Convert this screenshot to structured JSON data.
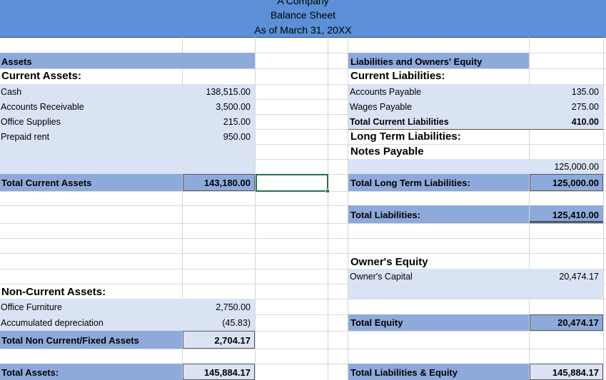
{
  "header": {
    "company": "A Company",
    "title": "Balance Sheet",
    "date": "As of March 31, 20XX"
  },
  "assets": {
    "heading": "Assets",
    "current_heading": "Current Assets:",
    "cash_label": "Cash",
    "cash_value": "138,515.00",
    "ar_label": "Accounts Receivable",
    "ar_value": "3,500.00",
    "supplies_label": "Office Supplies",
    "supplies_value": "215.00",
    "rent_label": "Prepaid rent",
    "rent_value": "950.00",
    "total_current_label": "Total Current Assets",
    "total_current_value": "143,180.00",
    "noncurrent_heading": "Non-Current Assets:",
    "furniture_label": "Office Furniture",
    "furniture_value": "2,750.00",
    "depreciation_label": "Accumulated depreciation",
    "depreciation_value": "(45.83)",
    "total_noncurrent_label": "Total Non Current/Fixed Assets",
    "total_noncurrent_value": "2,704.17",
    "total_label": "Total Assets:",
    "total_value": "145,884.17"
  },
  "liabilities": {
    "heading": "Liabilities and Owners' Equity",
    "current_heading": "Current Liabilities:",
    "ap_label": "Accounts Payable",
    "ap_value": "135.00",
    "wages_label": "Wages Payable",
    "wages_value": "275.00",
    "total_current_label": "Total Current Liabilities",
    "total_current_value": "410.00",
    "longterm_heading": "Long Term Liabilities:",
    "notes_label": "Notes Payable",
    "notes_value": "125,000.00",
    "total_longterm_label": "Total Long Term Liabilities:",
    "total_longterm_value": "125,000.00",
    "total_label": "Total Liabilities:",
    "total_value": "125,410.00"
  },
  "equity": {
    "heading": "Owner's Equity",
    "capital_label": "Owner's Capital",
    "capital_value": "20,474.17",
    "total_label": "Total Equity",
    "total_value": "20,474.17",
    "total_liab_equity_label": "Total Liabilities & Equity",
    "total_liab_equity_value": "145,884.17"
  }
}
